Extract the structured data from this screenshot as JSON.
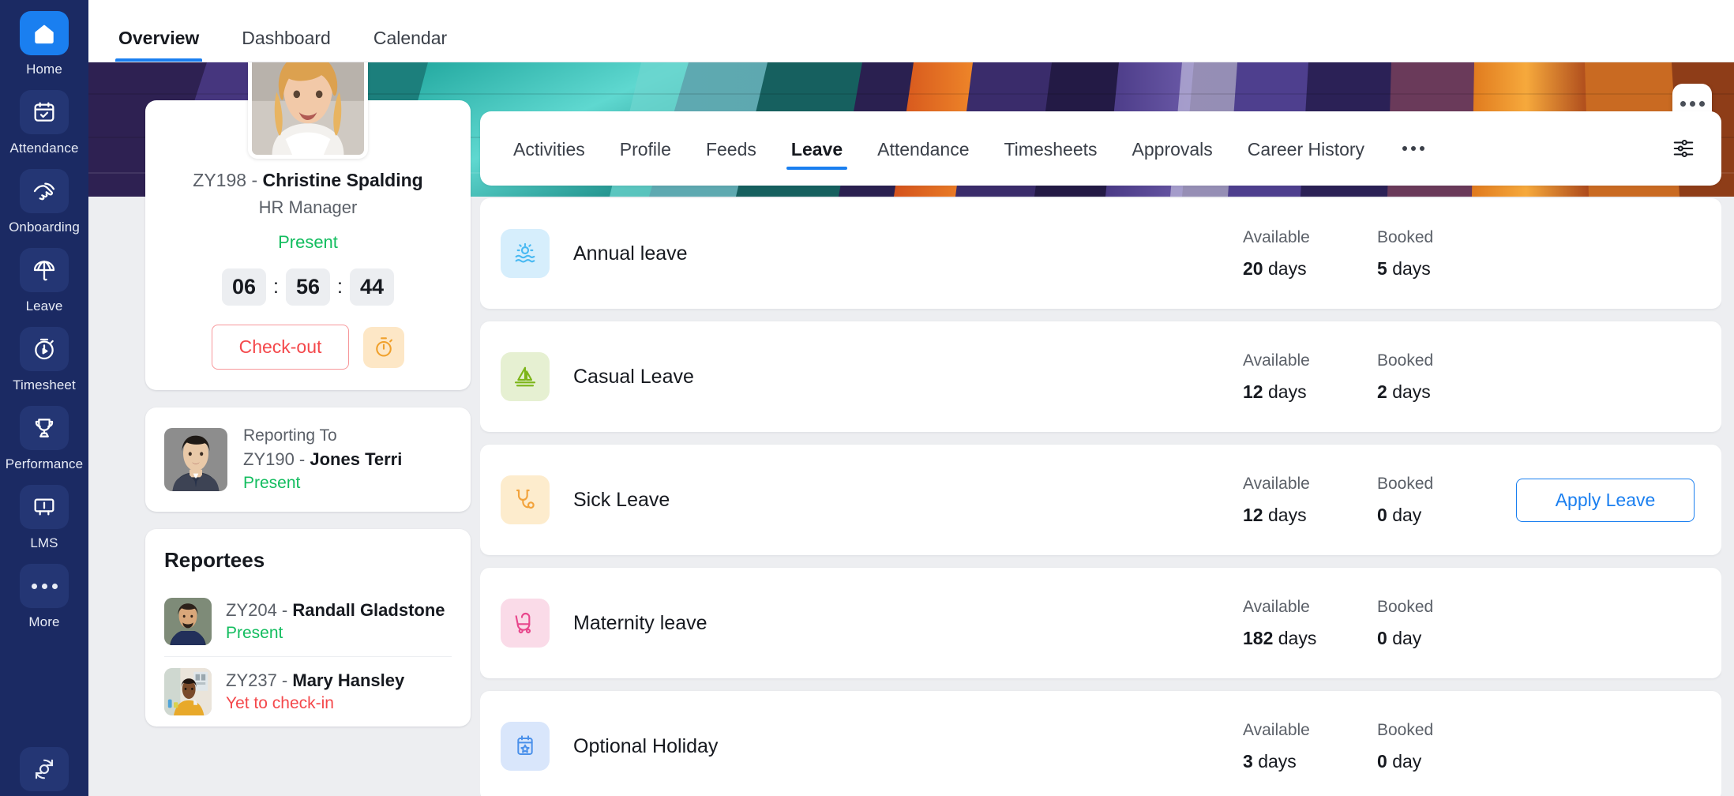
{
  "sidebar": {
    "items": [
      {
        "label": "Home",
        "icon": "home-icon",
        "active": true
      },
      {
        "label": "Attendance",
        "icon": "calendar-check-icon",
        "active": false
      },
      {
        "label": "Onboarding",
        "icon": "handshake-icon",
        "active": false
      },
      {
        "label": "Leave",
        "icon": "beach-umbrella-icon",
        "active": false
      },
      {
        "label": "Timesheet",
        "icon": "stopwatch-play-icon",
        "active": false
      },
      {
        "label": "Performance",
        "icon": "trophy-icon",
        "active": false
      },
      {
        "label": "LMS",
        "icon": "whiteboard-icon",
        "active": false
      },
      {
        "label": "More",
        "icon": "ellipsis-icon",
        "active": false
      }
    ],
    "bottom_icon": "sync-refresh-icon"
  },
  "topbar": {
    "tabs": [
      {
        "label": "Overview",
        "active": true
      },
      {
        "label": "Dashboard",
        "active": false
      },
      {
        "label": "Calendar",
        "active": false
      }
    ]
  },
  "banner": {
    "more_icon": "ellipsis-icon"
  },
  "profile": {
    "avatar": "employee-photo",
    "employee_id": "ZY198 - ",
    "name": "Christine Spalding",
    "role": "HR Manager",
    "status": "Present",
    "timer": {
      "hours": "06",
      "minutes": "56",
      "seconds": "44",
      "separator": ":"
    },
    "checkout_label": "Check-out",
    "timer_icon": "stopwatch-icon"
  },
  "reporting": {
    "title": "Reporting To",
    "employee_id": "ZY190 - ",
    "name": "Jones Terri",
    "status": "Present",
    "avatar": "manager-photo"
  },
  "reportees": {
    "title": "Reportees",
    "items": [
      {
        "employee_id": "ZY204 - ",
        "name": "Randall Gladstone",
        "status": "Present",
        "status_type": "present",
        "avatar": "reportee-photo-1"
      },
      {
        "employee_id": "ZY237 - ",
        "name": "Mary Hansley",
        "status": "Yet to check-in",
        "status_type": "pending",
        "avatar": "reportee-photo-2"
      }
    ]
  },
  "detail_tabs": {
    "tabs": [
      {
        "label": "Activities",
        "active": false
      },
      {
        "label": "Profile",
        "active": false
      },
      {
        "label": "Feeds",
        "active": false
      },
      {
        "label": "Leave",
        "active": true
      },
      {
        "label": "Attendance",
        "active": false
      },
      {
        "label": "Timesheets",
        "active": false
      },
      {
        "label": "Approvals",
        "active": false
      },
      {
        "label": "Career History",
        "active": false
      }
    ],
    "overflow_icon": "ellipsis-icon",
    "filter_icon": "sliders-filter-icon"
  },
  "leave": {
    "columns": {
      "available": "Available",
      "booked": "Booked"
    },
    "apply_label": "Apply Leave",
    "rows": [
      {
        "name": "Annual leave",
        "icon": "sun-waves-icon",
        "icon_bg": "#d6eefc",
        "icon_color": "#49b9f2",
        "available": "20",
        "available_unit": "days",
        "booked": "5",
        "booked_unit": "days",
        "show_apply": false
      },
      {
        "name": "Casual Leave",
        "icon": "sailboat-icon",
        "icon_bg": "#e6f0d2",
        "icon_color": "#7cb518",
        "available": "12",
        "available_unit": "days",
        "booked": "2",
        "booked_unit": "days",
        "show_apply": false
      },
      {
        "name": "Sick Leave",
        "icon": "stethoscope-icon",
        "icon_bg": "#fdeccd",
        "icon_color": "#f2a33c",
        "available": "12",
        "available_unit": "days",
        "booked": "0",
        "booked_unit": "day",
        "show_apply": true
      },
      {
        "name": "Maternity leave",
        "icon": "stroller-icon",
        "icon_bg": "#fadbe8",
        "icon_color": "#e8468c",
        "available": "182",
        "available_unit": "days",
        "booked": "0",
        "booked_unit": "day",
        "show_apply": false
      },
      {
        "name": "Optional Holiday",
        "icon": "calendar-star-icon",
        "icon_bg": "#d9e6fb",
        "icon_color": "#4a90ea",
        "available": "3",
        "available_unit": "days",
        "booked": "0",
        "booked_unit": "day",
        "show_apply": false
      }
    ]
  },
  "colors": {
    "sidebar_bg": "#1b2a63",
    "accent": "#1a7ff0",
    "present": "#13bd5f",
    "pending": "#f4484b",
    "page_bg": "#edeef1"
  }
}
